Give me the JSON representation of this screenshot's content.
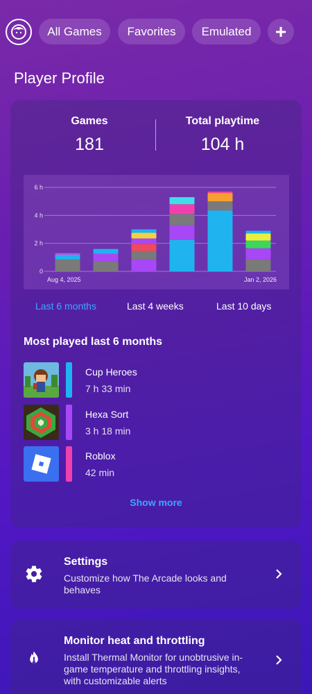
{
  "header": {
    "chips": [
      "All Games",
      "Favorites",
      "Emulated"
    ],
    "add_label": "+"
  },
  "page_title": "Player Profile",
  "stats": {
    "games_label": "Games",
    "games_value": "181",
    "playtime_label": "Total playtime",
    "playtime_value": "104 h"
  },
  "chart_data": {
    "type": "bar",
    "stacked": true,
    "x_start_label": "Aug 4, 2025",
    "x_end_label": "Jan 2, 2026",
    "yticks": [
      "0",
      "2 h",
      "4 h",
      "6 h"
    ],
    "ylim": [
      0,
      6
    ],
    "grid": true,
    "bars": [
      [
        {
          "v": 0.85,
          "c": "#7a7a7a"
        },
        {
          "v": 0.35,
          "c": "#1fb4f0"
        },
        {
          "v": 0.1,
          "c": "#e93ee0"
        }
      ],
      [
        {
          "v": 0.7,
          "c": "#7a7a7a"
        },
        {
          "v": 0.55,
          "c": "#a847f5"
        },
        {
          "v": 0.35,
          "c": "#1fb4f0"
        }
      ],
      [
        {
          "v": 0.85,
          "c": "#a847f5"
        },
        {
          "v": 0.6,
          "c": "#7a7a7a"
        },
        {
          "v": 0.5,
          "c": "#f04a5a"
        },
        {
          "v": 0.4,
          "c": "#a847f5"
        },
        {
          "v": 0.4,
          "c": "#f5d040"
        },
        {
          "v": 0.25,
          "c": "#1fb4f0"
        }
      ],
      [
        {
          "v": 2.25,
          "c": "#1fb4f0"
        },
        {
          "v": 1.05,
          "c": "#a847f5"
        },
        {
          "v": 0.8,
          "c": "#7a7a7a"
        },
        {
          "v": 0.7,
          "c": "#f040b0"
        },
        {
          "v": 0.5,
          "c": "#3fdfe8"
        }
      ],
      [
        {
          "v": 4.35,
          "c": "#1fb4f0"
        },
        {
          "v": 0.65,
          "c": "#7a7a7a"
        },
        {
          "v": 0.6,
          "c": "#f5a030"
        },
        {
          "v": 0.1,
          "c": "#f04a8a"
        }
      ],
      [
        {
          "v": 0.85,
          "c": "#7a7a7a"
        },
        {
          "v": 0.8,
          "c": "#a847f5"
        },
        {
          "v": 0.55,
          "c": "#3ad85a"
        },
        {
          "v": 0.5,
          "c": "#e8f040"
        },
        {
          "v": 0.2,
          "c": "#1fb4f0"
        }
      ]
    ]
  },
  "periods": {
    "active": "Last 6 months",
    "weeks": "Last 4 weeks",
    "days": "Last 10 days"
  },
  "most_played": {
    "title": "Most played last 6 months",
    "games": [
      {
        "name": "Cup Heroes",
        "time": "7 h 33 min",
        "color": "#1fb4f0"
      },
      {
        "name": "Hexa Sort",
        "time": "3 h 18 min",
        "color": "#a847f5"
      },
      {
        "name": "Roblox",
        "time": "42 min",
        "color": "#f040b0"
      }
    ],
    "show_more": "Show more"
  },
  "settings": {
    "title": "Settings",
    "desc": "Customize how The Arcade looks and behaves"
  },
  "monitor": {
    "title": "Monitor heat and throttling",
    "desc": "Install Thermal Monitor for unobtrusive in-game temperature and throttling insights, with customizable alerts"
  }
}
